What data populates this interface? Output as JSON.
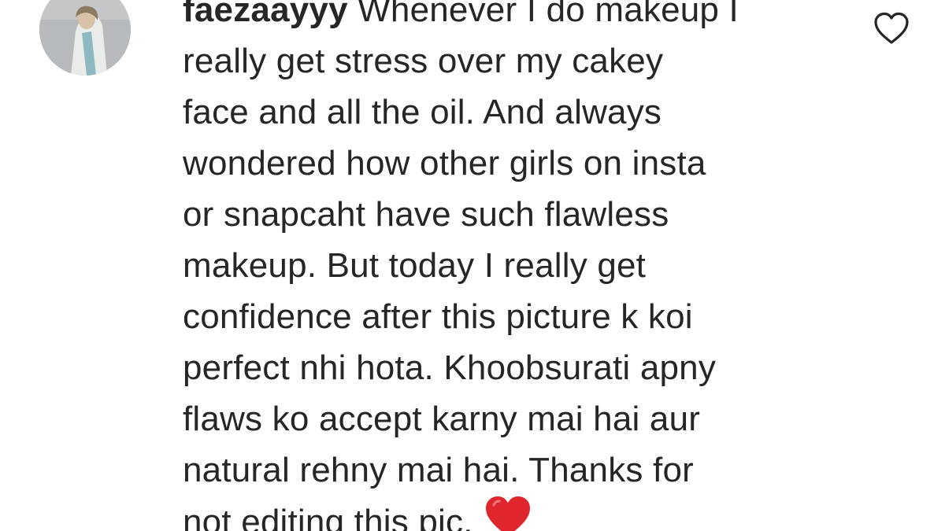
{
  "comment": {
    "username": "faezaayyy",
    "lines": [
      " Whenever I do makeup I",
      "really get stress over my cakey",
      "face and all the oil. And always",
      "wondered how other girls on insta",
      "or snapcaht have such flawless",
      "makeup. But today I really get",
      "confidence after this picture k koi",
      "perfect nhi hota. Khoobsurati apny",
      "flaws ko accept karny mai hai aur",
      "natural rehny mai hai. Thanks for",
      "not editing this pic."
    ],
    "emoji": "red-heart-emoji",
    "emoji_color": "#e0262d"
  },
  "like_button": {
    "icon": "heart-outline-icon"
  },
  "avatar": {
    "icon": "profile-photo"
  }
}
